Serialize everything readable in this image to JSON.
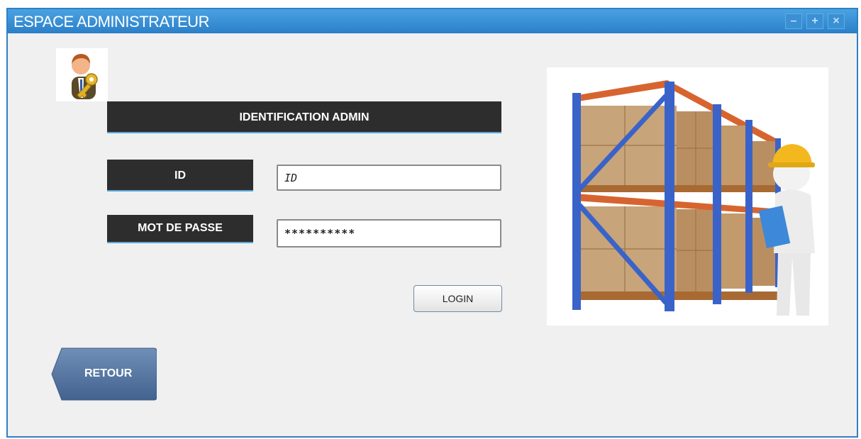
{
  "window": {
    "title": "ESPACE ADMINISTRATEUR",
    "controls": [
      "minimize-icon",
      "maximize-icon",
      "close-icon"
    ]
  },
  "form": {
    "heading": "IDENTIFICATION ADMIN",
    "id_label": "ID",
    "id_value": "ID",
    "password_label": "MOT DE PASSE",
    "password_value": "**********",
    "login_label": "LOGIN"
  },
  "back_button": {
    "label": "RETOUR"
  },
  "colors": {
    "titlebar": "#3a90d8",
    "label_bg": "#2d2d2d",
    "back_button": "#4f73a1",
    "rack_blue": "#3a63c9",
    "rack_orange": "#d7642f"
  }
}
